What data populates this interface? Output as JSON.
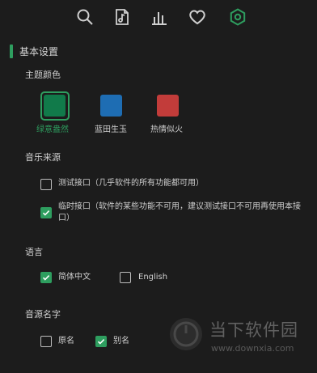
{
  "header": {
    "icons": [
      "search-icon",
      "music-file-icon",
      "chart-icon",
      "heart-icon",
      "settings-gear-icon"
    ],
    "active_color": "#2e9e5f"
  },
  "basic": {
    "title": "基本设置",
    "theme_label": "主题颜色",
    "themes": [
      {
        "label": "绿意盎然",
        "color": "#117a4a",
        "selected": true
      },
      {
        "label": "蓝田生玉",
        "color": "#1e6db3",
        "selected": false
      },
      {
        "label": "热情似火",
        "color": "#c23c3a",
        "selected": false
      }
    ]
  },
  "music_source": {
    "label": "音乐来源",
    "options": [
      {
        "text": "测试接口（几乎软件的所有功能都可用）",
        "checked": false
      },
      {
        "text": "临时接口（软件的某些功能不可用，建议测试接口不可用再使用本接口）",
        "checked": true
      }
    ]
  },
  "language": {
    "label": "语言",
    "options": [
      {
        "text": "简体中文",
        "checked": true
      },
      {
        "text": "English",
        "checked": false
      }
    ]
  },
  "source_name": {
    "label": "音源名字",
    "options": [
      {
        "text": "原名",
        "checked": false
      },
      {
        "text": "别名",
        "checked": true
      }
    ]
  },
  "watermark": {
    "name": "当下软件园",
    "url": "www.downxia.com"
  }
}
